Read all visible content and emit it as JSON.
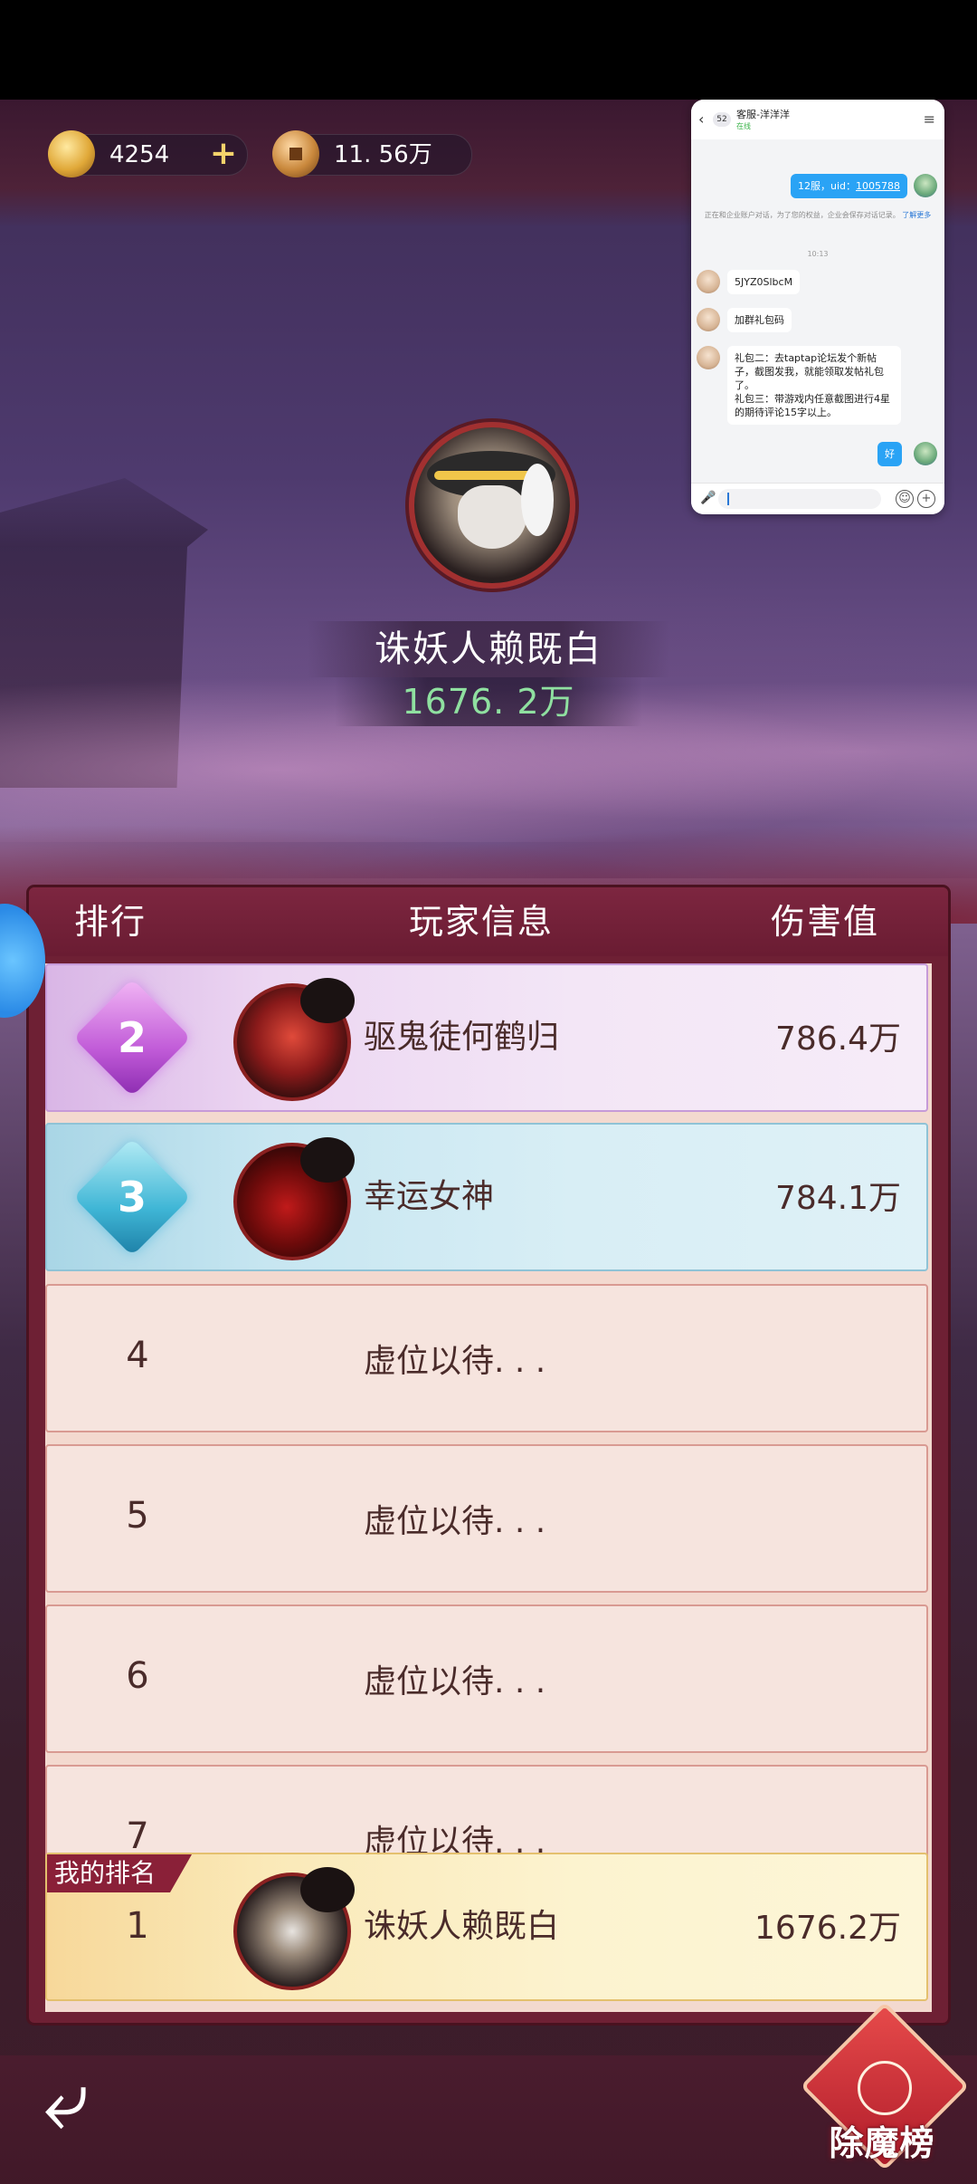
{
  "currency": {
    "gold_amount": "4254",
    "plus_symbol": "+",
    "copper_amount": "11. 56万"
  },
  "chat": {
    "unread_count": "52",
    "title": "客服-洋洋洋",
    "status": "在线",
    "msg_uid": "12服，uid：",
    "msg_uid_value": "1005788",
    "system_note": "正在和企业账户对话，为了您的权益，企业会保存对话记录。",
    "system_note_link": "了解更多",
    "time": "10:13",
    "msg_code": "5JYZ0SlbcM",
    "msg_group": "加群礼包码",
    "msg_gifts": "礼包二：去taptap论坛发个新帖子，截图发我，就能领取发帖礼包了。\n礼包三：带游戏内任意截图进行4星的期待评论15字以上。",
    "msg_ok": "好"
  },
  "champion": {
    "name": "诛妖人赖既白",
    "damage": "1676. 2万"
  },
  "table": {
    "col_rank": "排行",
    "col_info": "玩家信息",
    "col_damage": "伤害值"
  },
  "rows": [
    {
      "rank": "2",
      "name": "驱鬼徒何鹤归",
      "damage": "786.4万"
    },
    {
      "rank": "3",
      "name": "幸运女神",
      "damage": "784.1万"
    },
    {
      "rank": "4",
      "name": "虚位以待. . .",
      "damage": ""
    },
    {
      "rank": "5",
      "name": "虚位以待. . .",
      "damage": ""
    },
    {
      "rank": "6",
      "name": "虚位以待. . .",
      "damage": ""
    },
    {
      "rank": "7",
      "name": "虚位以待. . .",
      "damage": ""
    }
  ],
  "my_rank": {
    "tag": "我的排名",
    "rank": "1",
    "name": "诛妖人赖既白",
    "damage": "1676.2万"
  },
  "nav": {
    "back_icon": "back-arrow-icon",
    "board_label": "除魔榜"
  },
  "colors": {
    "panel": "#6e2034",
    "damage_green": "#8fe0a0",
    "rank2": "#c15bd8",
    "rank3": "#3fb6d6"
  }
}
